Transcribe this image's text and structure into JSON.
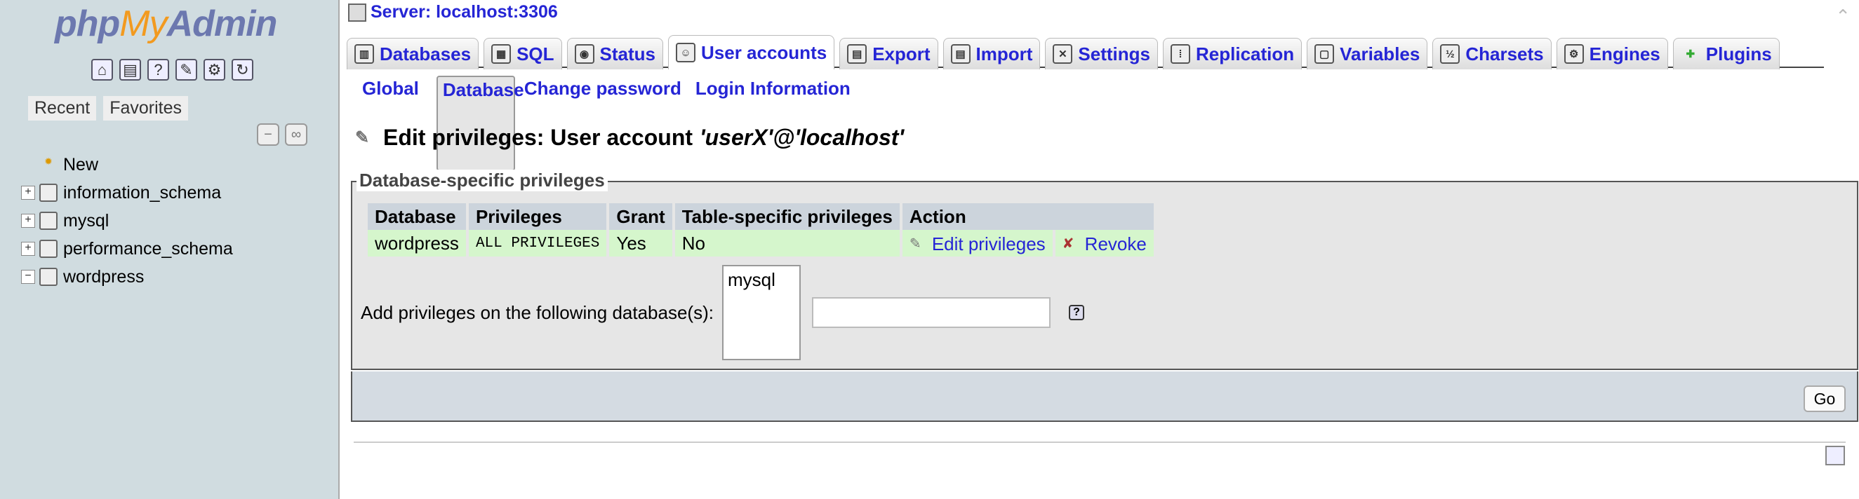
{
  "logo": {
    "php": "php",
    "my": "My",
    "admin": "Admin"
  },
  "nav_tabs": [
    "Recent",
    "Favorites"
  ],
  "tree": [
    "New",
    "information_schema",
    "mysql",
    "performance_schema",
    "wordpress"
  ],
  "server_title": "Server: localhost:3306",
  "tabs": [
    "Databases",
    "SQL",
    "Status",
    "User accounts",
    "Export",
    "Import",
    "Settings",
    "Replication",
    "Variables",
    "Charsets",
    "Engines",
    "Plugins"
  ],
  "subtabs": [
    "Global",
    "Database",
    "Change password",
    "Login Information"
  ],
  "heading": {
    "prefix": "Edit privileges: User account ",
    "account": "'userX'@'localhost'"
  },
  "legend": "Database-specific privileges",
  "table": {
    "headers": [
      "Database",
      "Privileges",
      "Grant",
      "Table-specific privileges",
      "Action"
    ],
    "row": {
      "database": "wordpress",
      "privileges": "ALL PRIVILEGES",
      "grant": "Yes",
      "table_specific": "No",
      "edit": "Edit privileges",
      "revoke": "Revoke"
    }
  },
  "add_label": "Add privileges on the following database(s):",
  "db_option": "mysql",
  "go": "Go"
}
